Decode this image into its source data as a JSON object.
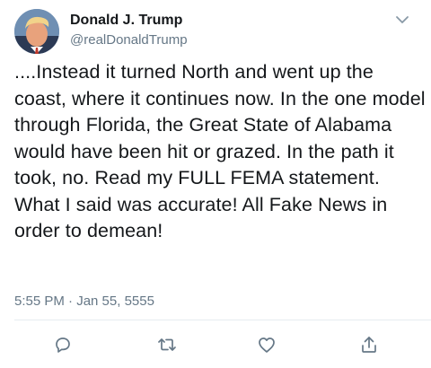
{
  "author": {
    "display_name": "Donald J. Trump",
    "handle": "@realDonaldTrump",
    "avatar": "profile-photo"
  },
  "tweet": {
    "text": "....Instead it turned North and went up the coast, where it continues now. In the one model through Florida, the Great State of Alabama would have been hit or grazed. In the path it took, no. Read my FULL FEMA statement. What I said was accurate! All Fake News in order to demean!",
    "timestamp": "5:55 PM · Jan 55, 5555"
  },
  "actions": [
    {
      "icon": "reply-icon"
    },
    {
      "icon": "retweet-icon"
    },
    {
      "icon": "like-icon"
    },
    {
      "icon": "share-icon"
    }
  ],
  "colors": {
    "text": "#14171a",
    "secondary": "#657786",
    "divider": "#e6ecf0"
  }
}
